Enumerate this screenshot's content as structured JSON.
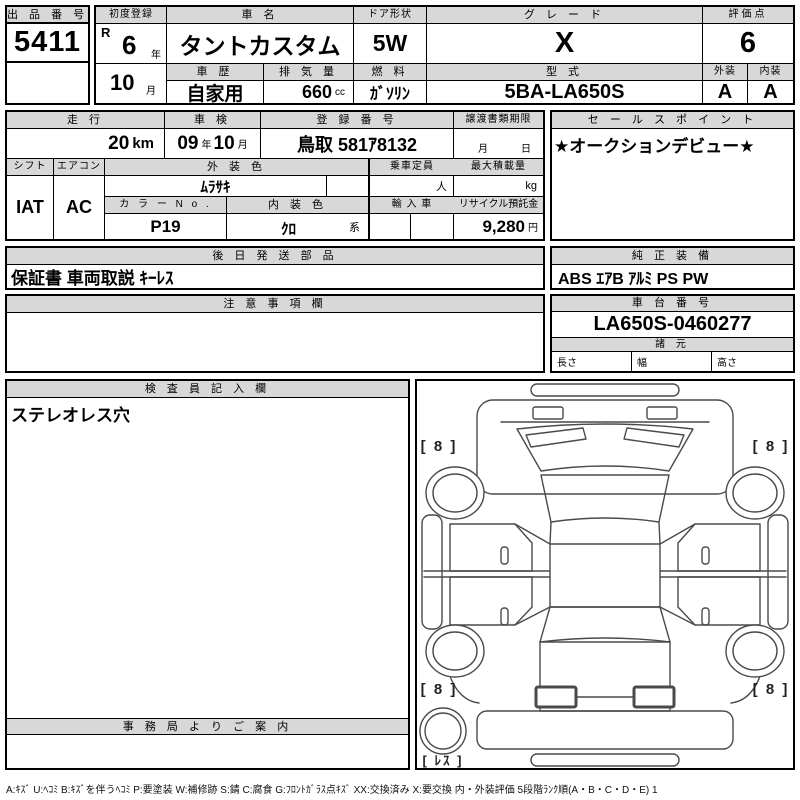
{
  "top": {
    "auction_no_label": "出 品 番 号",
    "auction_no": "5411",
    "first_reg_label": "初度登録",
    "first_reg_era": "R",
    "first_reg_year": "6",
    "first_reg_year_unit": "年",
    "first_reg_month": "10",
    "first_reg_month_unit": "月",
    "car_name_label": "車 名",
    "car_name": "タントカスタム",
    "history_label": "車 歴",
    "history": "自家用",
    "displacement_label": "排 気 量",
    "displacement": "660",
    "displacement_unit": "cc",
    "door_label": "ドア形状",
    "door": "5W",
    "fuel_label": "燃 料",
    "fuel": "ｶﾞｿﾘﾝ",
    "grade_label": "グ レ ー ド",
    "grade": "X",
    "model_label": "型 式",
    "model": "5BA-LA650S",
    "score_label": "評価点",
    "score": "6",
    "exterior_label": "外装",
    "exterior": "A",
    "interior_label": "内装",
    "interior": "A"
  },
  "mid": {
    "mileage_label": "走 行",
    "mileage": "20",
    "mileage_unit": "km",
    "inspection_label": "車 検",
    "inspection_year": "09",
    "inspection_year_unit": "年",
    "inspection_month": "10",
    "inspection_month_unit": "月",
    "reg_no_label": "登 録 番 号",
    "reg_no": "鳥取 581ｱ8132",
    "transfer_label": "譲渡書類期限",
    "transfer_month_unit": "月",
    "transfer_day_unit": "日",
    "shift_label": "シフト",
    "shift": "IAT",
    "aircon_label": "エアコン",
    "aircon": "AC",
    "ext_color_label": "外 装 色",
    "ext_color": "ﾑﾗｻｷ",
    "color_no_label": "カ ラ ー N o .",
    "color_no": "P19",
    "int_color_label": "内 装 色",
    "int_color": "ｸﾛ",
    "int_color_suffix": "系",
    "capacity_label": "乗車定員",
    "capacity_unit": "人",
    "max_load_label": "最大積載量",
    "max_load_unit": "kg",
    "import_label": "輸 入 車",
    "recycle_label": "リサイクル預託金",
    "recycle_value": "9,280",
    "recycle_unit": "円",
    "sales_point_label": "セ ー ル ス ポ イ ン ト",
    "sales_point": "★オークションデビュー★"
  },
  "sections": {
    "later_parts_label": "後 日 発 送 部 品",
    "later_parts": "保証書 車両取説 ｷｰﾚｽ",
    "oem_equip_label": "純 正 装 備",
    "oem_equip": "ABS ｴｱB ｱﾙﾐ PS PW",
    "notes_label": "注 意 事 項 欄",
    "notes": "",
    "chassis_label": "車 台 番 号",
    "chassis_no": "LA650S-0460277",
    "spec_label": "諸 元",
    "length_label": "長さ",
    "width_label": "幅",
    "height_label": "高さ",
    "inspector_label": "検 査 員 記 入 欄",
    "inspector_note": "ステレオレス穴",
    "office_label": "事 務 局 よ り ご 案 内",
    "office_note": ""
  },
  "diagram": {
    "tire_front_left": "[ 8 ]",
    "tire_front_right": "[ 8 ]",
    "tire_rear_left": "[ 8 ]",
    "tire_rear_right": "[ 8 ]",
    "spare_label": "[ ﾚｽ ]"
  },
  "legend": "A:ｷｽﾞ U:ﾍｺﾐ B:ｷｽﾞを伴うﾍｺﾐ P:要塗装 W:補修跡 S:錆 C:腐食 G:ﾌﾛﾝﾄｶﾞﾗｽ点ｷｽﾞ XX:交換済み X:要交換  内・外装評価 5段階ﾗﾝｸ順(A・B・C・D・E) 1"
}
